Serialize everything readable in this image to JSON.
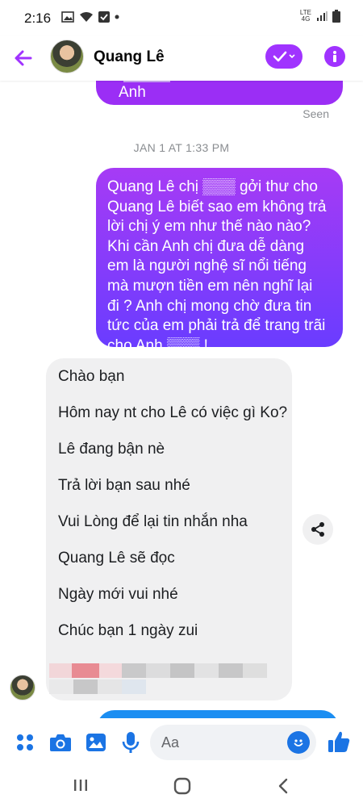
{
  "status_bar": {
    "time": "2:16",
    "network": "LTE",
    "network_sub": "4G"
  },
  "header": {
    "contact_name": "Quang Lê"
  },
  "conversation": {
    "prev_message_tail": "cho Anh",
    "prev_message_tail_end": "!",
    "seen_label": "Seen",
    "timestamp": "JAN 1 AT 1:33 PM",
    "outgoing_message": "Quang Lê chị ▒▒▒ gởi thư cho\nQuang Lê biết sao em không trả\nlời chị ý em như thế nào nào?\nKhi cần Anh chị đưa dễ dàng\nem là người nghệ sĩ nổi tiếng\nmà mượn tiền em nên nghĩ lại\nđi ? Anh chị mong chờ đưa tin\ntức của em phải trả để trang trãi\ncho Anh ▒▒▒ !",
    "auto_reply_lines": [
      "Chào bạn",
      "Hôm nay nt cho Lê có việc gì Ko?",
      "Lê đang bận nè",
      "Trả lời bạn sau nhé",
      "Vui Lòng để lại tin nhắn nha",
      "Quang Lê sẽ đọc",
      "Ngày mới vui nhé",
      "Chúc bạn 1 ngày zui"
    ]
  },
  "composer": {
    "placeholder": "Aa"
  },
  "colors": {
    "accent_purple": "#a033ff",
    "outgoing_gradient_top": "#a63bf5",
    "outgoing_gradient_bottom": "#6a3cff",
    "incoming_bubble": "#f0f0f1",
    "messenger_blue": "#1b74e4"
  },
  "icons": {
    "back": "arrow-left-icon",
    "check": "check-icon",
    "info": "info-icon",
    "share": "share-icon",
    "apps": "four-dots-icon",
    "camera": "camera-icon",
    "gallery": "image-icon",
    "mic": "microphone-icon",
    "emoji": "emoji-icon",
    "like": "thumbs-up-icon"
  }
}
